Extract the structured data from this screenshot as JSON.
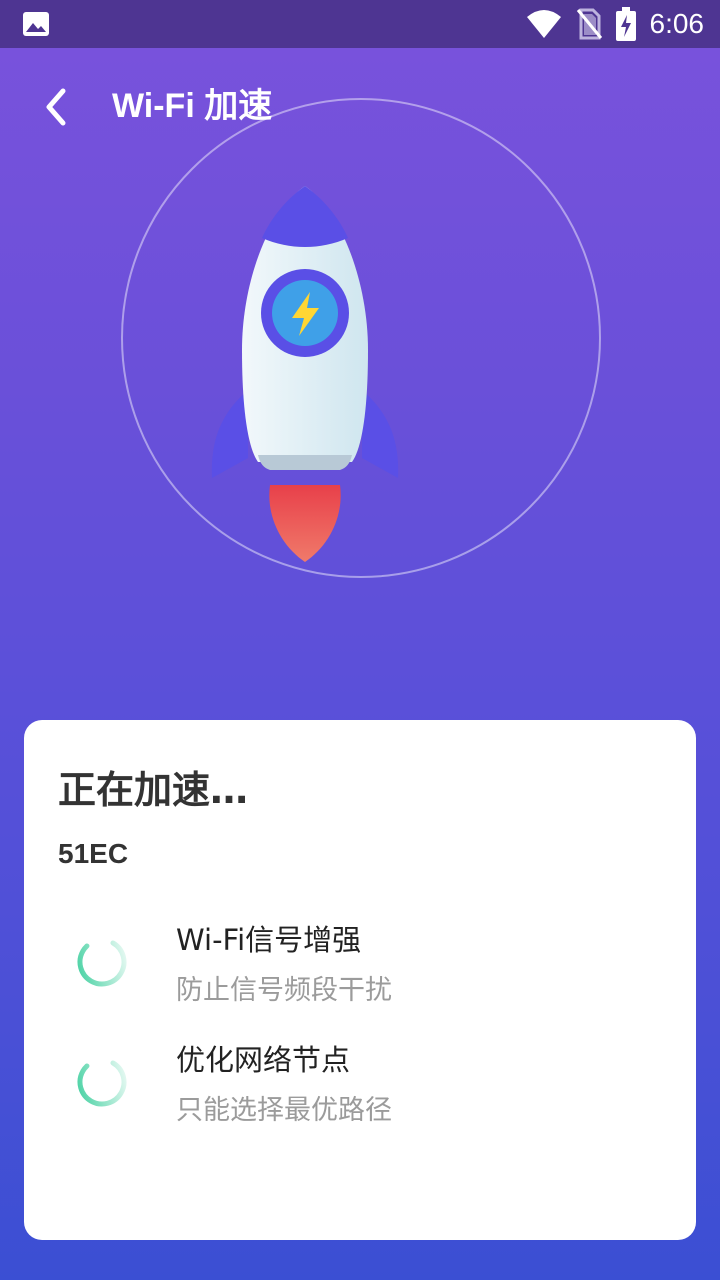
{
  "status_bar": {
    "time": "6:06",
    "icons": [
      "image-icon",
      "wifi-icon",
      "no-sim-icon",
      "battery-charging-icon"
    ]
  },
  "header": {
    "back_icon": "chevron-left-icon",
    "title": "Wi-Fi 加速"
  },
  "hero": {
    "icon": "rocket-icon",
    "badge_icon": "lightning-icon"
  },
  "card": {
    "title": "正在加速…",
    "ssid": "51EC",
    "tasks": [
      {
        "title": "Wi-Fi信号增强",
        "subtitle": "防止信号频段干扰",
        "status_icon": "loading-spinner-icon"
      },
      {
        "title": "优化网络节点",
        "subtitle": "只能选择最优路径",
        "status_icon": "loading-spinner-icon"
      }
    ]
  },
  "colors": {
    "gradient_top": "#7a52dc",
    "gradient_bottom": "#3b4fd3",
    "status_bar": "#4e3592",
    "rocket_body": "#dbeef5",
    "rocket_accent": "#5a4fe6",
    "flame": "#e8504a",
    "spinner": "#3ecf9e"
  }
}
